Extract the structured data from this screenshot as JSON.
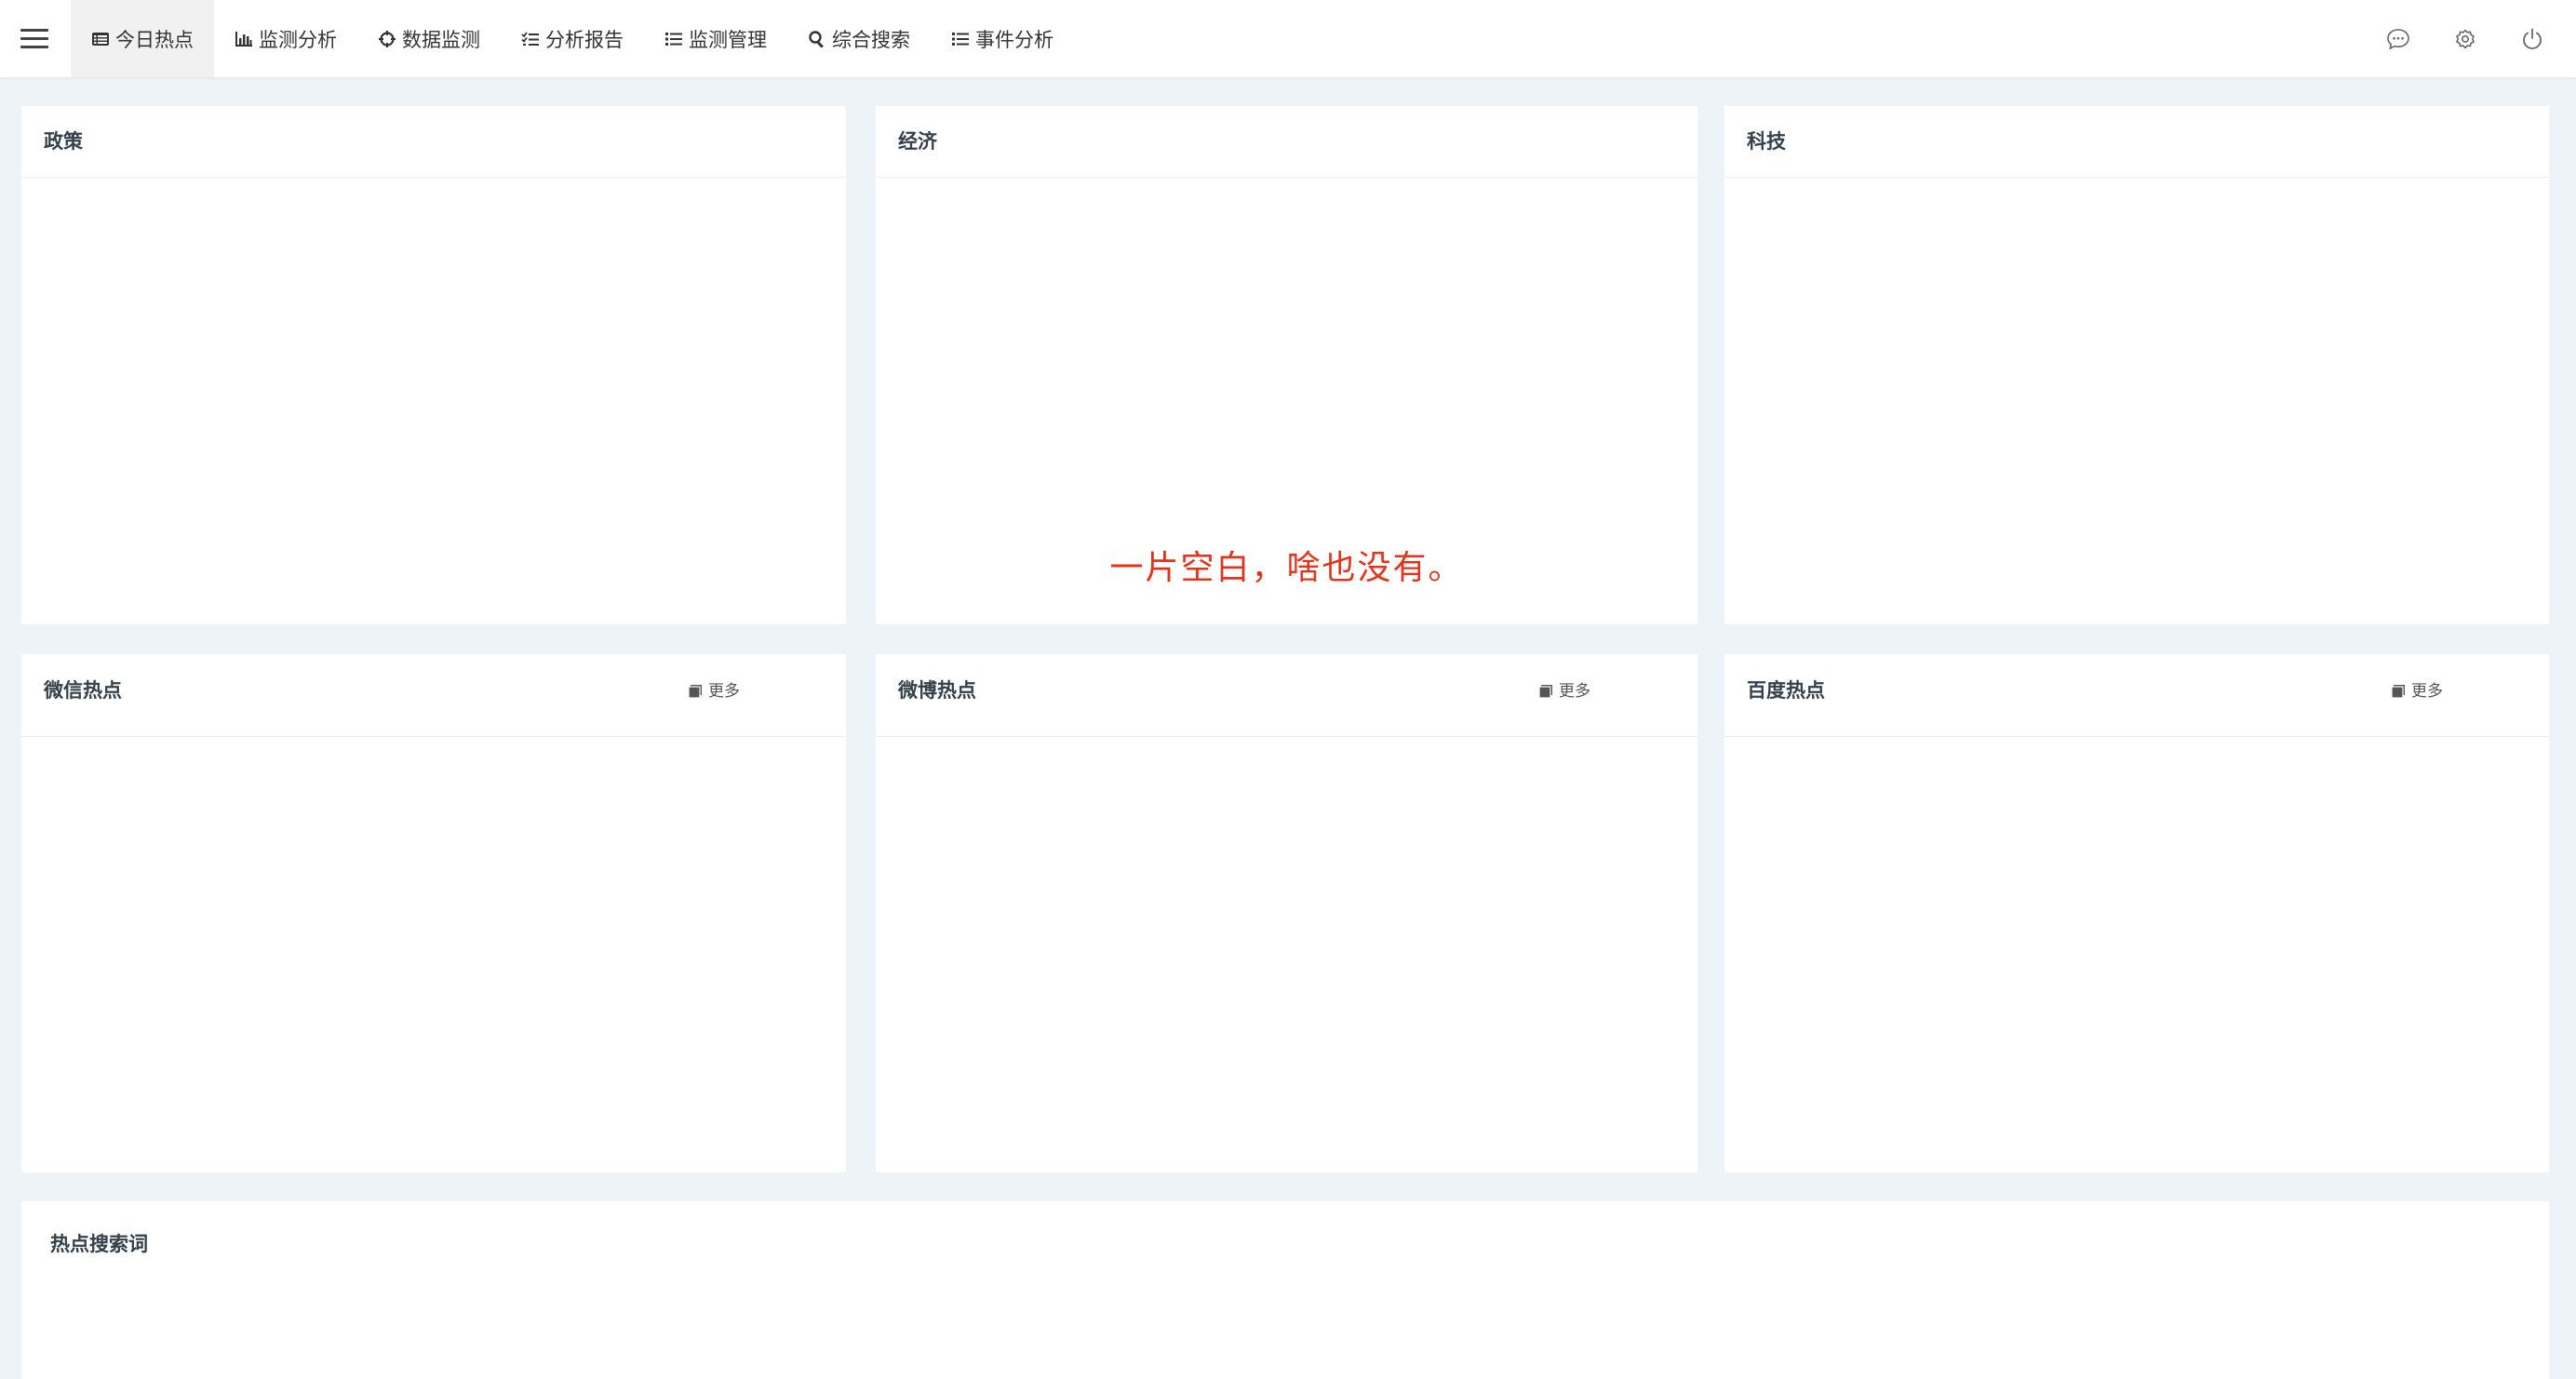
{
  "nav": {
    "items": [
      {
        "label": "今日热点",
        "icon": "list-alt-icon",
        "active": true
      },
      {
        "label": "监测分析",
        "icon": "bar-chart-icon",
        "active": false
      },
      {
        "label": "数据监测",
        "icon": "crosshairs-icon",
        "active": false
      },
      {
        "label": "分析报告",
        "icon": "tasks-icon",
        "active": false
      },
      {
        "label": "监测管理",
        "icon": "list-icon",
        "active": false
      },
      {
        "label": "综合搜索",
        "icon": "search-icon",
        "active": false
      },
      {
        "label": "事件分析",
        "icon": "list-icon",
        "active": false
      }
    ]
  },
  "tools": [
    {
      "icon": "message-icon"
    },
    {
      "icon": "settings-icon"
    },
    {
      "icon": "power-icon"
    }
  ],
  "panels": {
    "policy": {
      "title": "政策"
    },
    "economy": {
      "title": "经济",
      "empty_message": "一片空白，啥也没有。"
    },
    "tech": {
      "title": "科技"
    },
    "wechat": {
      "title": "微信热点",
      "more_label": "更多"
    },
    "weibo": {
      "title": "微博热点",
      "more_label": "更多"
    },
    "baidu": {
      "title": "百度热点",
      "more_label": "更多"
    },
    "search_terms": {
      "title": "热点搜索词"
    }
  },
  "colors": {
    "background": "#eef3f7",
    "panel": "#ffffff",
    "title_text": "#34404b",
    "empty_text": "#e4331c",
    "active_tab": "#f1f1f1"
  }
}
